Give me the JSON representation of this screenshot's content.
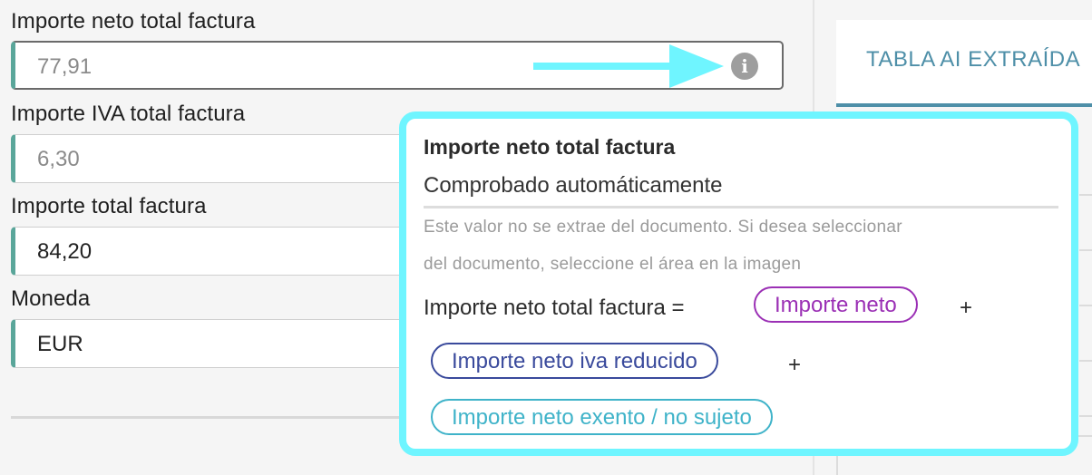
{
  "fields": [
    {
      "label": "Importe neto total factura",
      "value": "77,91"
    },
    {
      "label": "Importe IVA total factura",
      "value": "6,30"
    },
    {
      "label": "Importe total factura",
      "value": "84,20"
    },
    {
      "label": "Moneda",
      "value": "EUR"
    }
  ],
  "tab": {
    "label": "TABLA AI EXTRAÍDA"
  },
  "tooltip": {
    "title": "Importe neto total factura",
    "subtitle": "Comprobado automáticamente",
    "note_line1": "Este valor no se extrae del documento. Si desea seleccionar",
    "note_line2": "del documento, seleccione el área en la imagen",
    "formula_lhs": "Importe neto total factura =",
    "plus": "+",
    "chips": [
      {
        "label": "Importe neto",
        "color": "#9b30b5"
      },
      {
        "label": "Importe neto iva reducido",
        "color": "#3a4a9c"
      },
      {
        "label": "Importe neto exento / no sujeto",
        "color": "#3fb3c9"
      }
    ]
  },
  "icons": {
    "info": "info-icon",
    "arrow": "arrow-right-icon"
  },
  "colors": {
    "accent_teal": "#5aa69a",
    "highlight_cyan": "#6ff5ff",
    "tab_blue": "#4e8fa8"
  }
}
